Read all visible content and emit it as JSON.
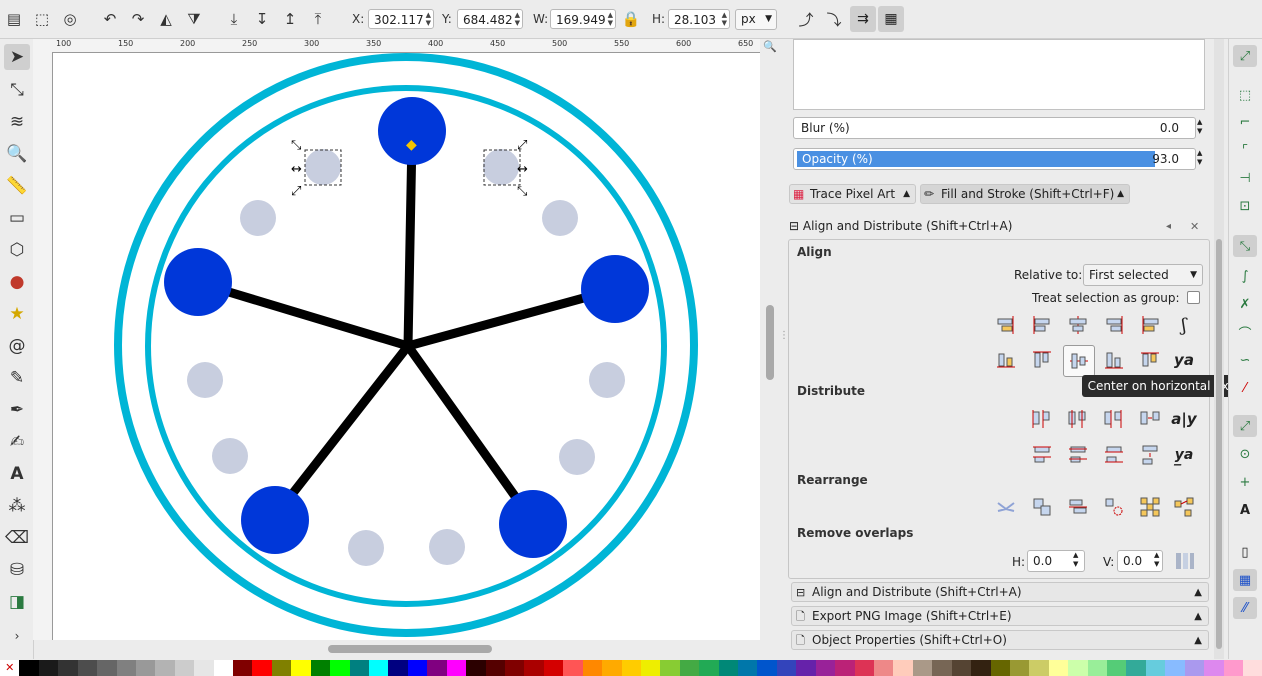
{
  "toolbar": {
    "x_label": "X:",
    "x_value": "302.117",
    "y_label": "Y:",
    "y_value": "684.482",
    "w_label": "W:",
    "w_value": "169.949",
    "h_label": "H:",
    "h_value": "28.103",
    "unit": "px"
  },
  "ruler": {
    "ticks": [
      "100",
      "150",
      "200",
      "250",
      "300",
      "350",
      "400",
      "450",
      "500",
      "550",
      "600",
      "650"
    ]
  },
  "panel": {
    "blur_label": "Blur (%)",
    "blur_value": "0.0",
    "opacity_label": "Opacity (%)",
    "opacity_value": "93.0",
    "tab_trace": "Trace Pixel Art",
    "tab_fill": "Fill and Stroke (Shift+Ctrl+F)",
    "align_title": "Align and Distribute (Shift+Ctrl+A)",
    "align_heading": "Align",
    "relative_to_label": "Relative to:",
    "relative_to_value": "First selected",
    "treat_group_label": "Treat selection as group:",
    "distribute_heading": "Distribute",
    "rearrange_heading": "Rearrange",
    "remove_overlaps_heading": "Remove overlaps",
    "h_label": "H:",
    "h_value": "0.0",
    "v_label": "V:",
    "v_value": "0.0",
    "tooltip": "Center on horizontal axis",
    "collapsed": [
      "Align and Distribute (Shift+Ctrl+A)",
      "Export PNG Image (Shift+Ctrl+E)",
      "Object Properties (Shift+Ctrl+O)"
    ]
  },
  "colors": {
    "ring": "#00b5d6",
    "node_blue": "#0037d9",
    "node_grey": "#c8cedf",
    "spoke": "#000000"
  }
}
